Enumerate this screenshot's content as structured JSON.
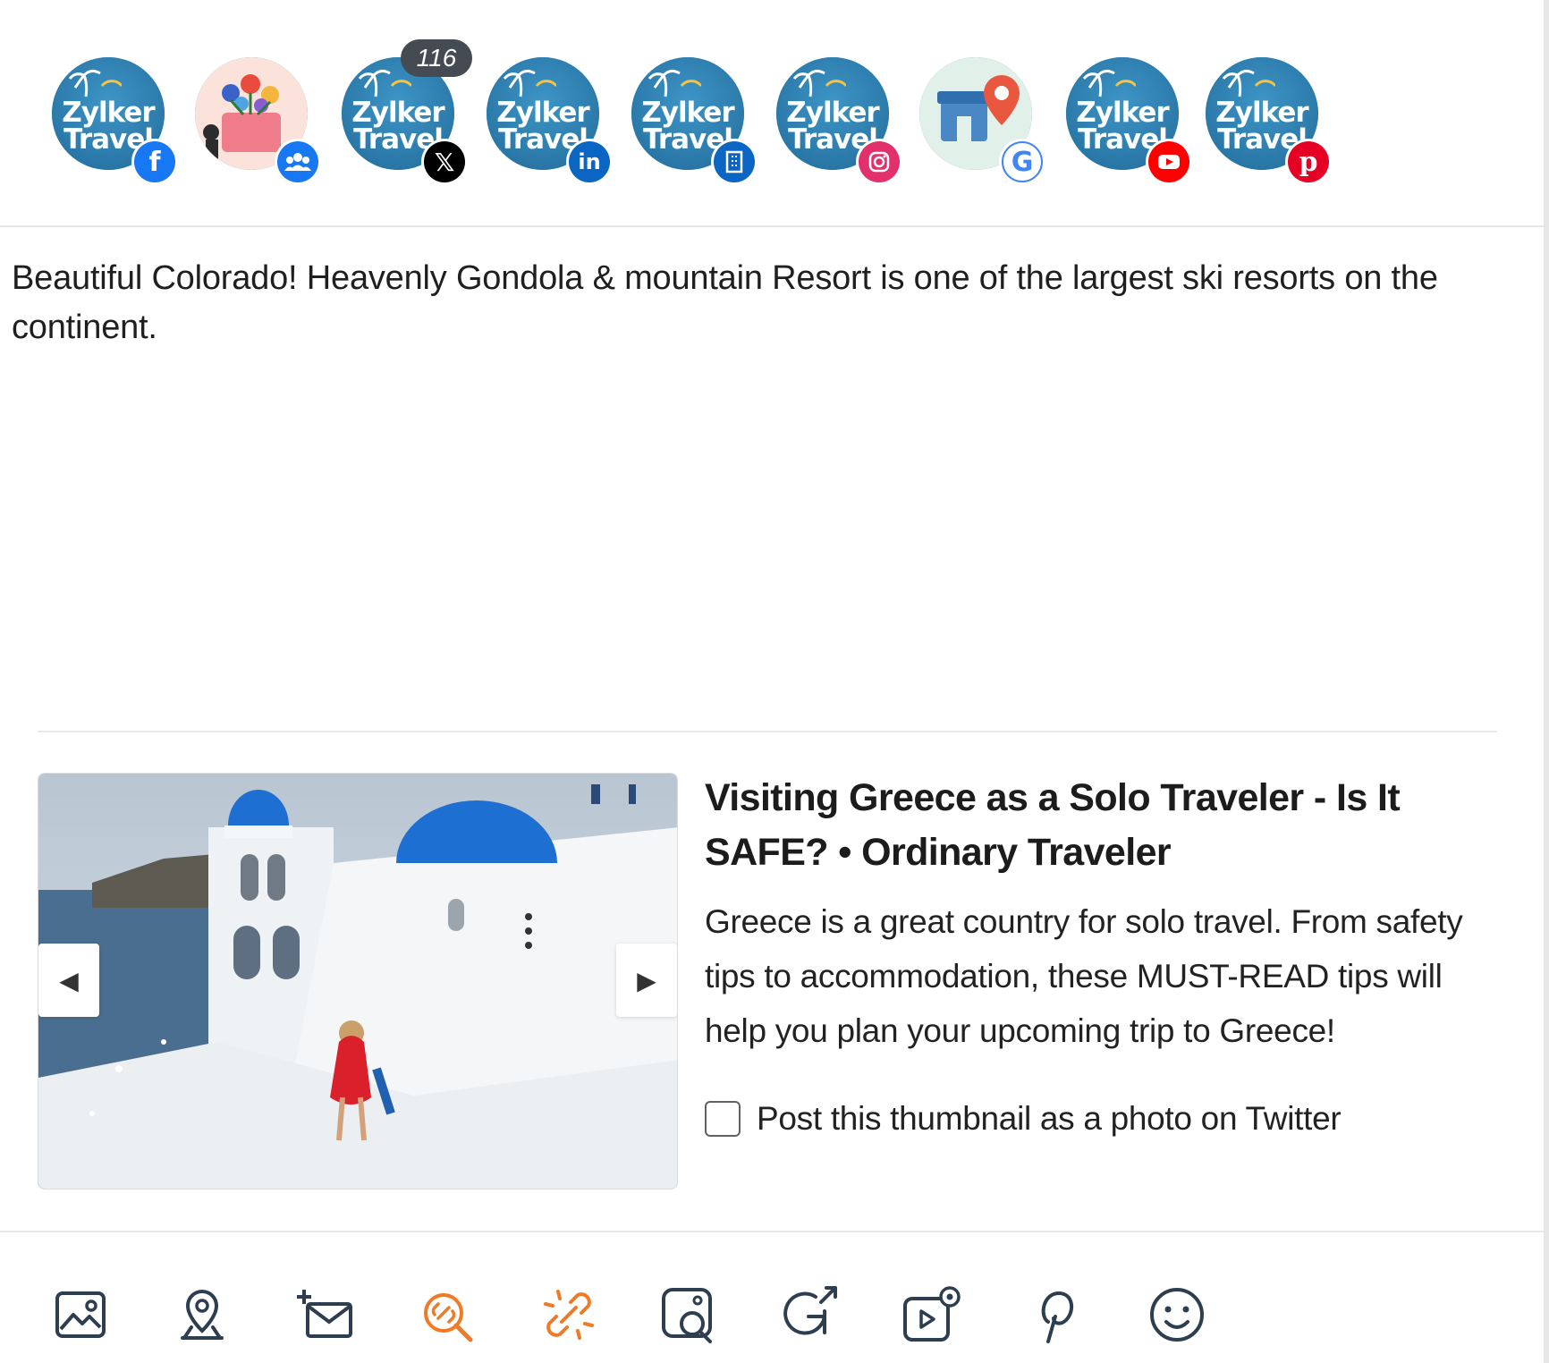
{
  "profiles": [
    {
      "name": "Zylker Travel",
      "network": "facebook",
      "icon": "facebook-icon",
      "badge_color": "#1877f2",
      "logo_line1": "Zylker",
      "logo_line2": "Travel"
    },
    {
      "name": "Community group",
      "network": "facebook-group",
      "icon": "group-icon",
      "badge_color": "#1877f2"
    },
    {
      "name": "Zylker Travel",
      "network": "x",
      "icon": "x-icon",
      "badge_color": "#000000",
      "count": "116",
      "logo_line1": "Zylker",
      "logo_line2": "Travel"
    },
    {
      "name": "Zylker Travel",
      "network": "linkedin",
      "icon": "linkedin-icon",
      "badge_color": "#0a66c2",
      "logo_line1": "Zylker",
      "logo_line2": "Travel"
    },
    {
      "name": "Zylker Travel",
      "network": "linkedin-page",
      "icon": "building-icon",
      "badge_color": "#0a66c2",
      "logo_line1": "Zylker",
      "logo_line2": "Travel"
    },
    {
      "name": "Zylker Travel",
      "network": "instagram",
      "icon": "instagram-icon",
      "badge_color": "#e1306c",
      "logo_line1": "Zylker",
      "logo_line2": "Travel"
    },
    {
      "name": "Google Business",
      "network": "google",
      "icon": "google-icon",
      "badge_color": "#4285f4"
    },
    {
      "name": "Zylker Travel",
      "network": "youtube",
      "icon": "youtube-icon",
      "badge_color": "#ff0000",
      "logo_line1": "Zylker",
      "logo_line2": "Travel"
    },
    {
      "name": "Zylker Travel",
      "network": "pinterest",
      "icon": "pinterest-icon",
      "badge_color": "#e60023",
      "logo_line1": "Zylker",
      "logo_line2": "Travel"
    }
  ],
  "message": "Beautiful Colorado! Heavenly Gondola & mountain Resort is one of the largest ski resorts on the continent.",
  "link_preview": {
    "title": "Visiting Greece as a Solo Traveler - Is It SAFE? • Ordinary Traveler",
    "description": "Greece is a great country for solo travel. From safety tips to accommodation, these MUST-READ tips will help you plan your upcoming trip to Greece!",
    "checkbox_label": "Post this thumbnail as a photo on Twitter",
    "checkbox_checked": false,
    "prev_arrow": "◀",
    "next_arrow": "▶"
  },
  "toolbar": {
    "tools": [
      "image-icon",
      "location-icon",
      "add-email-icon",
      "link-search-icon",
      "unlink-icon",
      "image-search-icon",
      "repost-icon",
      "video-settings-icon",
      "pinterest-icon",
      "emoji-icon"
    ],
    "accent_color": "#f07a26",
    "icon_color": "#2c3e50"
  }
}
